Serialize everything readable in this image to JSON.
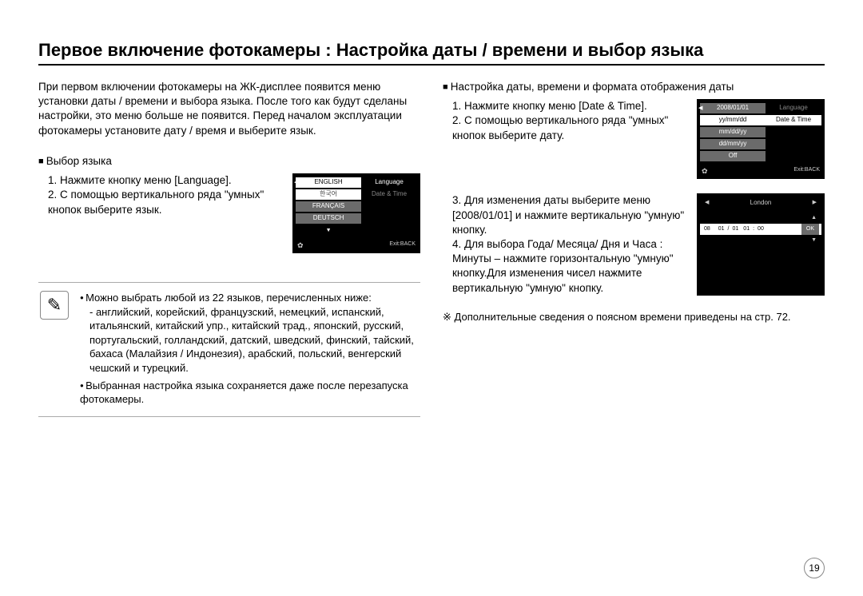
{
  "title": "Первое включение фотокамеры : Настройка даты / времени и выбор языка",
  "intro": "При первом включении фотокамеры на ЖК-дисплее появится меню установки даты / времени и выбора языка. После того как будут сделаны настройки, это меню больше не появится. Перед началом эксплуатации фотокамеры установите дату / время и выберите язык.",
  "lang": {
    "head": "Выбор языка",
    "s1": "1. Нажмите кнопку меню [Language].",
    "s2": "2. С помощью вертикального ряда \"умных\" кнопок выберите язык."
  },
  "lcd1": {
    "menu": [
      "ENGLISH",
      "한국어",
      "FRANÇAIS",
      "DEUTSCH"
    ],
    "right": [
      "Language",
      "Date & Time"
    ],
    "exit": "Exit:BACK"
  },
  "note": {
    "b1": "Можно выбрать любой из 22 языков, перечисленных ниже:",
    "b1s": "- английский, корейский, французский, немецкий, испанский, итальянский, китайский упр., китайский трад., японский, русский, португальский, голландский, датский, шведский, финский, тайский, бахаса (Малайзия / Индонезия), арабский, польский, венгерский чешский и турецкий.",
    "b2": "Выбранная настройка языка сохраняется даже после перезапуска фотокамеры."
  },
  "dt": {
    "head": "Настройка даты, времени и формата отображения даты",
    "s1": "1. Нажмите кнопку меню [Date & Time].",
    "s2": "2. С помощью вертикального ряда \"умных\" кнопок выберите дату.",
    "s3": "3. Для изменения даты выберите меню [2008/01/01] и нажмите вертикальную \"умную\" кнопку.",
    "s4": "4. Для выбора Года/ Месяца/ Дня и Часа : Минуты – нажмите горизонтальную \"умную\" кнопку.Для изменения чисел нажмите вертикальную \"умную\" кнопку."
  },
  "lcd2": {
    "menu": [
      "2008/01/01",
      "yy/mm/dd",
      "mm/dd/yy",
      "dd/mm/yy",
      "Off"
    ],
    "right": [
      "Language",
      "Date & Time"
    ],
    "exit": "Exit:BACK"
  },
  "lcd3": {
    "city": "London",
    "date": [
      "08",
      "01",
      "01",
      "01",
      "00"
    ],
    "ok": "OK"
  },
  "foot": "Дополнительные сведения о поясном времени приведены на стр. 72.",
  "page": "19"
}
